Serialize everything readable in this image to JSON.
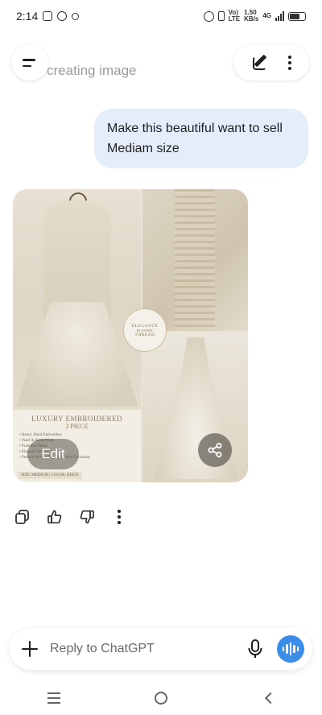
{
  "status_bar": {
    "time": "2:14",
    "network_top": "Vo)",
    "network_bottom": "LTE",
    "speed_top": "1.50",
    "speed_bottom": "KB/s",
    "gen": "4G"
  },
  "header": {
    "title": "creating image"
  },
  "conversation": {
    "user_message": "Make this beautiful want to sell Mediam size"
  },
  "generated_image": {
    "badge": {
      "line1": "ELEGANCE",
      "line2": "IN EVERY",
      "line3": "THREAD"
    },
    "promo": {
      "title": "LUXURY EMBROIDERED",
      "subtitle": "3 PIECE",
      "bullets": [
        "• Heavy Hand Embroidery",
        "• Pearl & Stone Work",
        "• Premium Fabric",
        "• Elegant Comfort",
        "• Perfect for Weddings & Festive Occasions"
      ],
      "footer": "SIZE: MEDIUM   |   COLOR: BEIGE"
    },
    "edit_label": "Edit"
  },
  "composer": {
    "placeholder": "Reply to ChatGPT"
  },
  "icons": {
    "menu": "menu-icon",
    "edit": "new-chat-icon",
    "more": "more-vertical-icon",
    "share": "share-icon",
    "copy": "copy-icon",
    "thumbs_up": "thumbs-up-icon",
    "thumbs_down": "thumbs-down-icon",
    "plus": "plus-icon",
    "mic": "mic-icon",
    "voice": "voice-mode-icon"
  },
  "colors": {
    "user_bubble": "#e4eefa",
    "voice_button": "#3b8ee8"
  }
}
